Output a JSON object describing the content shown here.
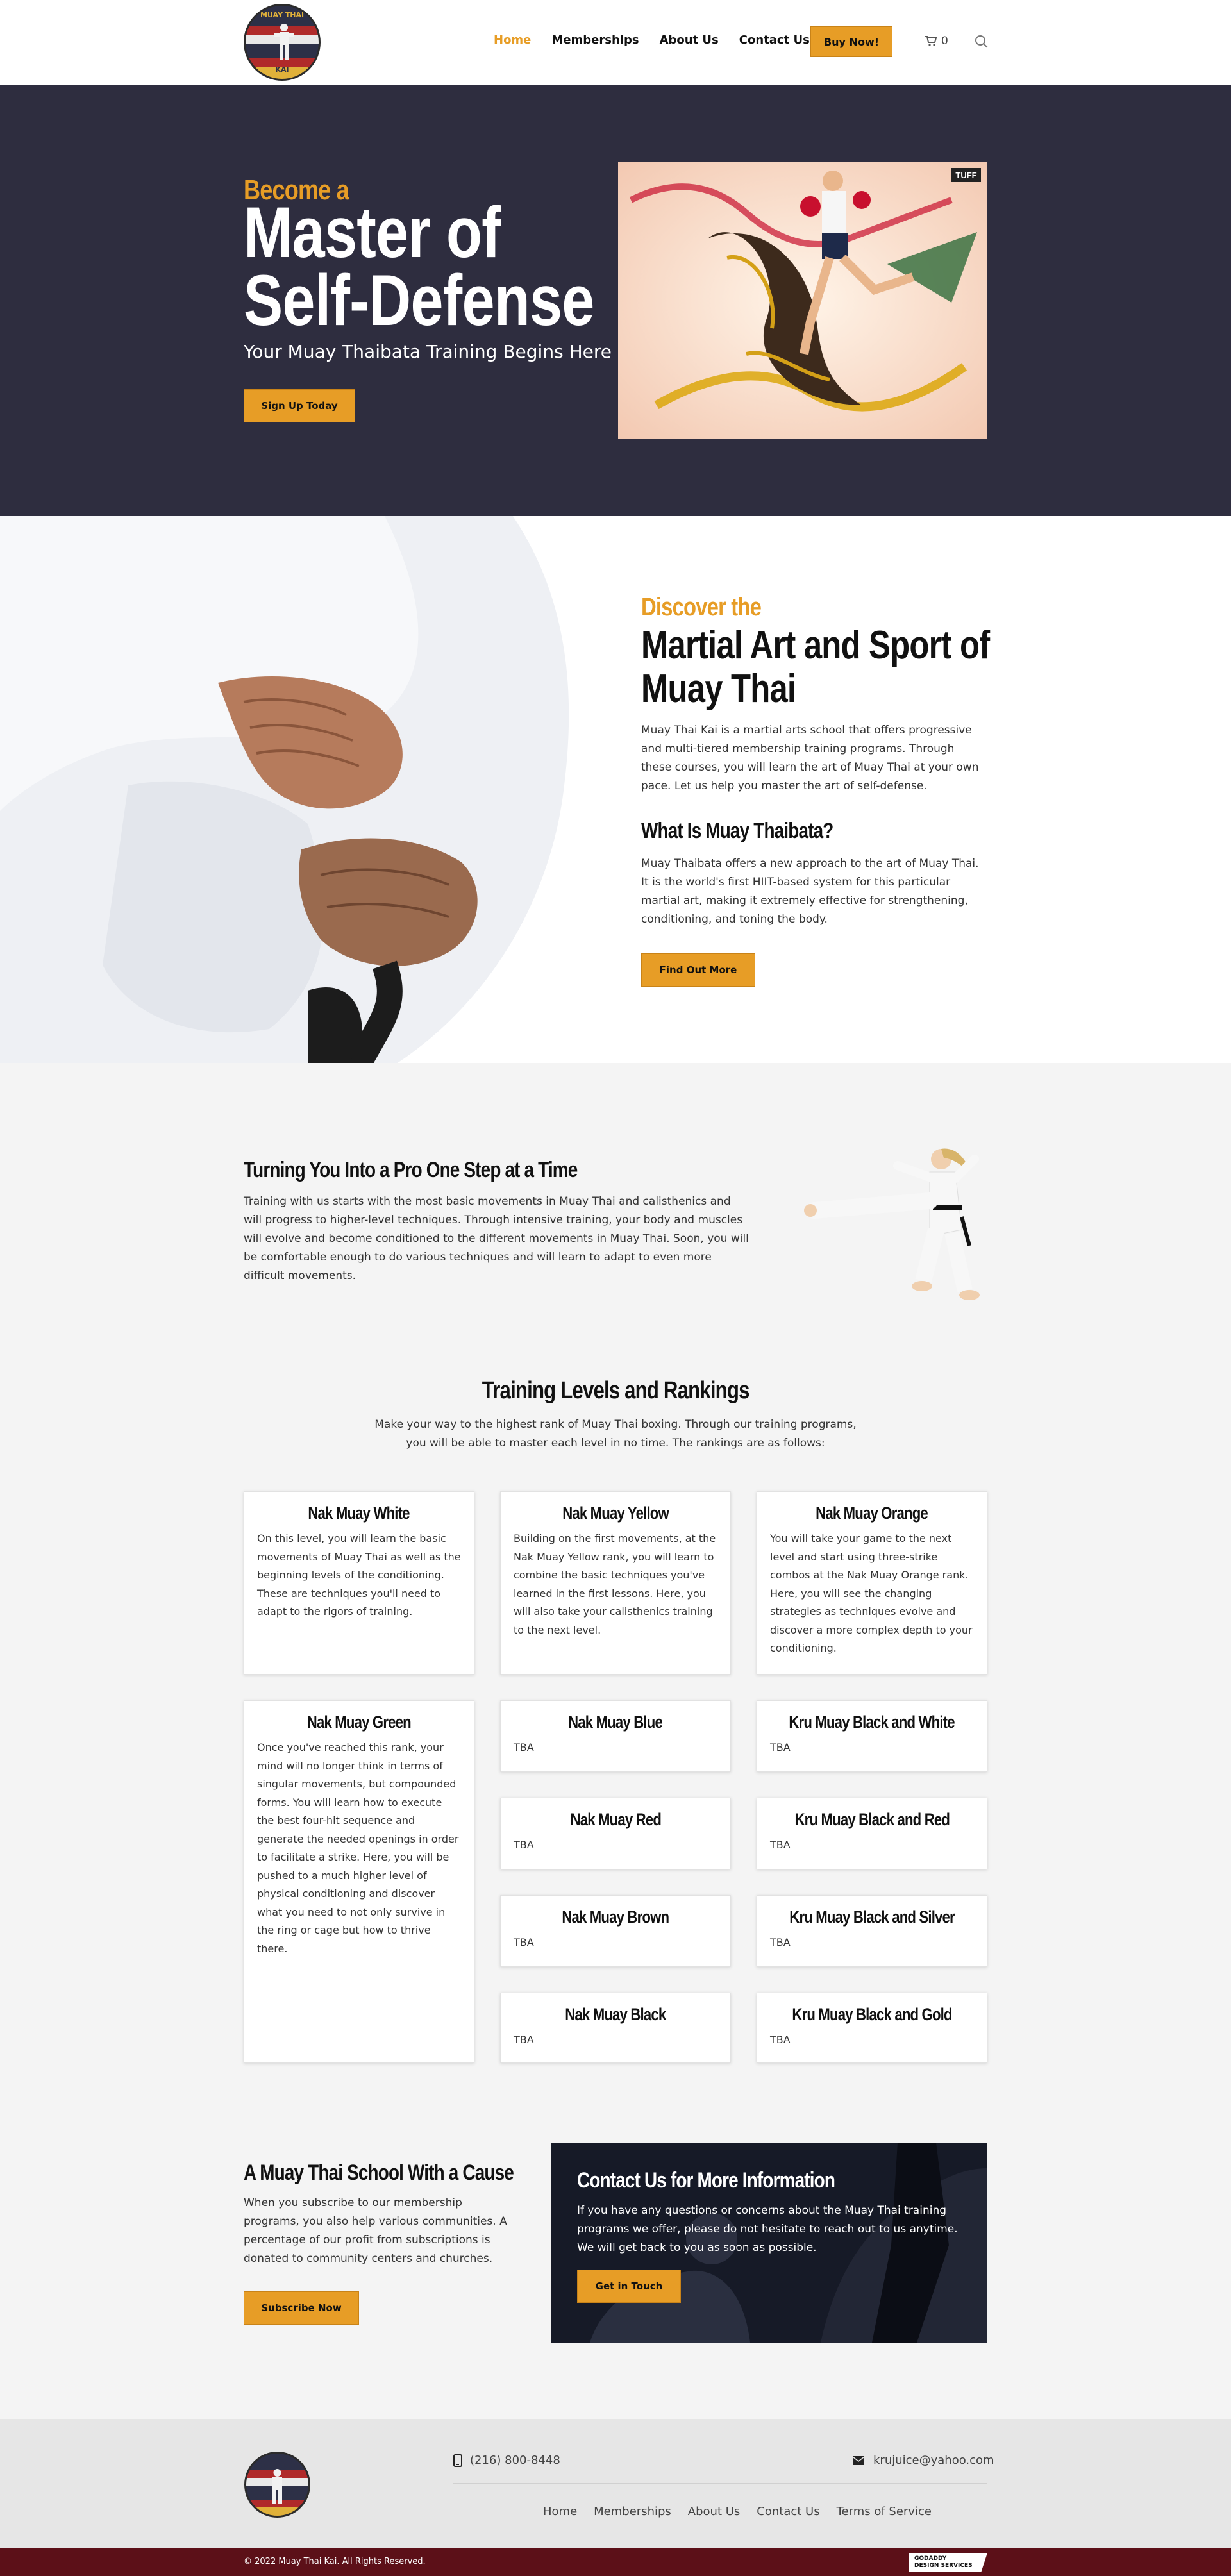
{
  "brand": {
    "logo_text_top": "MUAY THAI",
    "logo_text_bottom": "KAI",
    "accent_color": "#e79d26",
    "dark_color": "#2e2d3f",
    "footer_bar_color": "#5c1018"
  },
  "nav": {
    "items": [
      "Home",
      "Memberships",
      "About Us",
      "Contact Us"
    ],
    "active": "Home",
    "cta_label": "Buy Now!",
    "cart_count": "0",
    "icons": [
      "cart-icon",
      "search-icon"
    ]
  },
  "hero": {
    "kicker": "Become a",
    "title_line1": "Master of",
    "title_line2": "Self-Defense",
    "subtitle": "Your Muay Thaibata Training Begins Here",
    "cta_label": "Sign Up Today"
  },
  "about": {
    "kicker": "Discover the",
    "title_line1": "Martial Art and Sport of",
    "title_line2": "Muay Thai",
    "paragraph1": "Muay Thai Kai is a martial arts school that offers progressive and multi-tiered membership training programs. Through these courses, you will learn the art of Muay Thai at your own pace. Let us help you master the art of self-defense.",
    "subheading": "What Is Muay Thaibata?",
    "paragraph2": "Muay Thaibata offers a new approach to the art of Muay Thai. It is the world's first HIIT-based system for this particular martial art, making it extremely effective for strengthening, conditioning, and toning the body.",
    "cta_label": "Find Out More"
  },
  "training": {
    "heading": "Turning You Into a Pro One Step at a Time",
    "paragraph": "Training with us starts with the most basic movements in Muay Thai and calisthenics and will progress to higher-level techniques. Through intensive training, your body and muscles will evolve and become conditioned to the different movements in Muay Thai. Soon, you will be comfortable enough to do various techniques and will learn to adapt to even more difficult movements."
  },
  "levels": {
    "heading": "Training Levels and Rankings",
    "intro": "Make your way to the highest rank of Muay Thai boxing. Through our training programs, you will be able to master each level in no time. The rankings are as follows:",
    "cards": [
      {
        "title": "Nak Muay White",
        "text": "On this level, you will learn the basic movements of Muay Thai as well as the beginning levels of the conditioning. These are techniques you'll need to adapt to the rigors of training."
      },
      {
        "title": "Nak Muay Yellow",
        "text": "Building on the first movements, at the Nak Muay Yellow rank, you will learn to combine the basic techniques you've learned in the first lessons. Here, you will also take your calisthenics training to the next level."
      },
      {
        "title": "Nak Muay Orange",
        "text": "You will take your game to the next level and start using three-strike combos at the Nak Muay Orange rank. Here, you will see the changing strategies as techniques evolve and discover a more complex depth to your conditioning."
      },
      {
        "title": "Nak Muay Green",
        "text": "Once you've reached this rank, your mind will no longer think in terms of singular movements, but compounded forms. You will learn how to execute the best four-hit sequence and generate the needed openings in order to facilitate a strike. Here, you will be pushed to a much higher level of physical conditioning and discover what you need to not only survive in the ring or cage but how to thrive there."
      },
      {
        "title": "Nak Muay Blue",
        "text": "TBA"
      },
      {
        "title": "Kru Muay Black and White",
        "text": "TBA"
      },
      {
        "title": "Nak Muay Red",
        "text": "TBA"
      },
      {
        "title": "Kru Muay Black and Red",
        "text": "TBA"
      },
      {
        "title": "Nak Muay Brown",
        "text": "TBA"
      },
      {
        "title": "Kru Muay Black and Silver",
        "text": "TBA"
      },
      {
        "title": "Nak Muay Black",
        "text": "TBA"
      },
      {
        "title": "Kru Muay Black and Gold",
        "text": "TBA"
      }
    ]
  },
  "cause": {
    "heading": "A Muay Thai School With a Cause",
    "paragraph": "When you subscribe to our membership programs, you also help various communities. A percentage of our profit from subscriptions is donated to community centers and churches.",
    "cta_label": "Subscribe Now"
  },
  "contact": {
    "heading": "Contact Us for More Information",
    "paragraph": "If you have any questions or concerns about the Muay Thai training programs we offer, please do not hesitate to reach out to us anytime. We will get back to you as soon as possible.",
    "cta_label": "Get in Touch"
  },
  "footer": {
    "phone": "(216) 800-8448",
    "email": "krujuice@yahoo.com",
    "links": [
      "Home",
      "Memberships",
      "About Us",
      "Contact Us",
      "Terms of Service"
    ],
    "copyright": "© 2022 Muay Thai Kai. All Rights Reserved.",
    "badge_line1": "GODADDY",
    "badge_line2": "DESIGN SERVICES"
  }
}
